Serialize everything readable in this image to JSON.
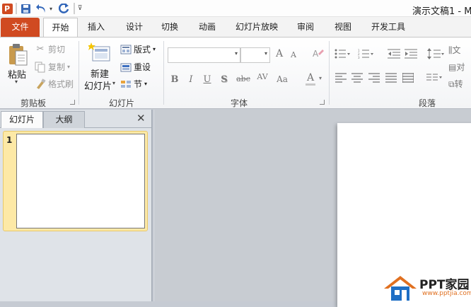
{
  "window": {
    "title": "演示文稿1 - M"
  },
  "qat": {
    "logo": "P"
  },
  "tabs": [
    "文件",
    "开始",
    "插入",
    "设计",
    "切换",
    "动画",
    "幻灯片放映",
    "审阅",
    "视图",
    "开发工具"
  ],
  "clipboard": {
    "paste": "粘贴",
    "cut": "剪切",
    "copy": "复制",
    "format_painter": "格式刷",
    "label": "剪贴板"
  },
  "slides_group": {
    "new_line1": "新建",
    "new_line2": "幻灯片",
    "layout": "版式",
    "reset": "重设",
    "section": "节",
    "label": "幻灯片"
  },
  "font_group": {
    "label": "字体",
    "bold": "B",
    "italic": "I",
    "underline": "U",
    "shadow": "S",
    "strike": "abc",
    "spacing": "AV",
    "case": "Aa",
    "color": "A",
    "grow": "A",
    "shrink": "A"
  },
  "para_group": {
    "label": "段落",
    "text_dir": "文",
    "align_text": "对",
    "convert": "转"
  },
  "panel": {
    "tab_slides": "幻灯片",
    "tab_outline": "大纲",
    "close": "✕",
    "slide_number": "1"
  },
  "watermark": {
    "text": "PPT家园",
    "sub": "www.pptjia.com"
  },
  "colors": {
    "file_tab": "#d04a21",
    "selection": "#fde9a6",
    "accent_orange": "#e07020",
    "accent_blue": "#1f6fc5"
  }
}
